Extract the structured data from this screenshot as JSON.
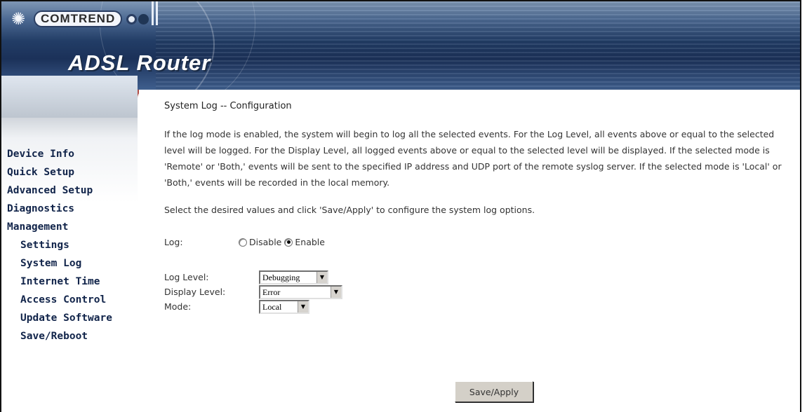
{
  "brand": {
    "logo_text": "COMTREND",
    "title": "ADSL Router"
  },
  "sidebar": {
    "items": [
      {
        "label": "Device Info",
        "sub": false
      },
      {
        "label": "Quick Setup",
        "sub": false
      },
      {
        "label": "Advanced Setup",
        "sub": false
      },
      {
        "label": "Diagnostics",
        "sub": false
      },
      {
        "label": "Management",
        "sub": false
      },
      {
        "label": "Settings",
        "sub": true
      },
      {
        "label": "System Log",
        "sub": true
      },
      {
        "label": "Internet Time",
        "sub": true
      },
      {
        "label": "Access Control",
        "sub": true
      },
      {
        "label": "Update Software",
        "sub": true
      },
      {
        "label": "Save/Reboot",
        "sub": true
      }
    ]
  },
  "main": {
    "heading": "System Log -- Configuration",
    "description": "If the log mode is enabled, the system will begin to log all the selected events. For the Log Level, all events above or equal to the selected level will be logged. For the Display Level, all logged events above or equal to the selected level will be displayed. If the selected mode is 'Remote' or 'Both,' events will be sent to the specified IP address and UDP port of the remote syslog server. If the selected mode is 'Local' or 'Both,' events will be recorded in the local memory.",
    "instruction": "Select the desired values and click 'Save/Apply' to configure the system log options.",
    "log": {
      "label": "Log:",
      "options": [
        {
          "label": "Disable",
          "checked": false
        },
        {
          "label": "Enable",
          "checked": true
        }
      ]
    },
    "log_level": {
      "label": "Log Level:",
      "value": "Debugging"
    },
    "display_level": {
      "label": "Display Level:",
      "value": "Error"
    },
    "mode": {
      "label": "Mode:",
      "value": "Local"
    },
    "save_label": "Save/Apply"
  },
  "colors": {
    "nav_text": "#11244a",
    "sidebar_border": "#b14d45",
    "header_dark": "#1b3159"
  }
}
